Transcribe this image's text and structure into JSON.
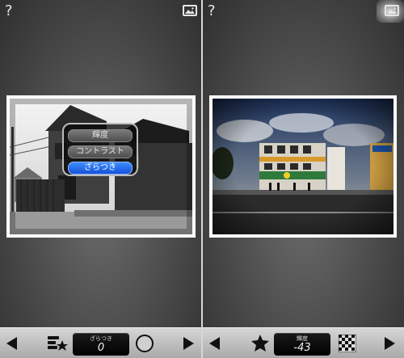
{
  "left": {
    "help_glyph": "?",
    "popup_items": [
      "輝度",
      "コントラスト",
      "ざらつき"
    ],
    "display": {
      "label": "ざらつき",
      "value": "0"
    },
    "icons": [
      "help-icon",
      "image-icon",
      "arrow-left-icon",
      "adjust-star-icon",
      "circle-icon",
      "arrow-right-icon"
    ]
  },
  "right": {
    "help_glyph": "?",
    "display": {
      "label": "輝度",
      "value": "-43"
    },
    "icons": [
      "help-icon",
      "image-icon",
      "arrow-left-icon",
      "star-icon",
      "checkerboard-icon",
      "arrow-right-icon"
    ]
  },
  "colors": {
    "selected": "#1f63e8",
    "lcd_bg": "#000000",
    "toolbar": "#bdbdbd"
  }
}
